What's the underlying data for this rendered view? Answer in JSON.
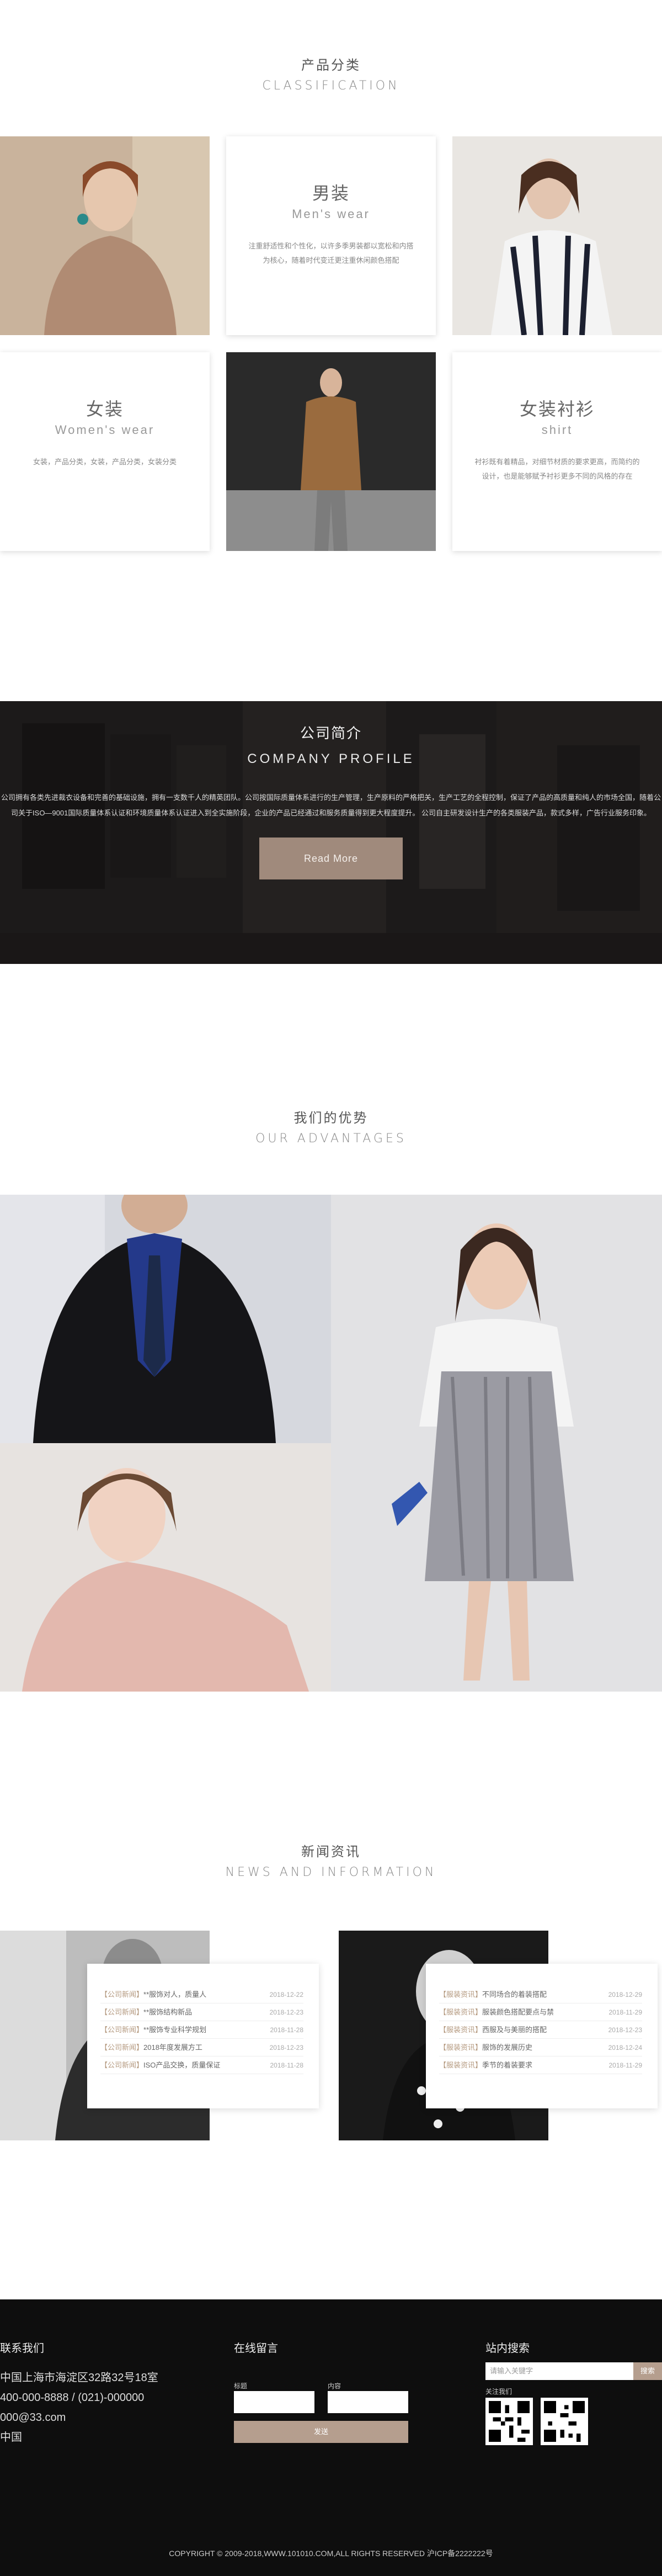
{
  "classification": {
    "title_cn": "产品分类",
    "title_en": "CLASSIFICATION",
    "cards": [
      {
        "cn": "男装",
        "en": "Men's wear",
        "desc": "注重舒适性和个性化，以许多季男装都以宽松和内搭为核心，随着时代变迁更注重休闲颜色搭配"
      },
      {
        "cn": "女装",
        "en": "Women's wear",
        "desc": "女装，产品分类，女装，产品分类，女装分类"
      },
      {
        "cn": "女装衬衫",
        "en": "shirt",
        "desc": "衬衫既有着精品，对细节材质的要求更高，而简约的设计，也是能够赋予衬衫更多不同的风格的存在"
      }
    ]
  },
  "profile": {
    "title_cn": "公司简介",
    "title_en": "COMPANY PROFILE",
    "text": "公司拥有各类先进裁衣设备和完善的基础设施，拥有一支数千人的精英团队。公司按国际质量体系进行的生产管理，生产原料的严格把关，生产工艺的全程控制，保证了产品的高质量和纯人的市场全国，随着公司关于ISO—9001国际质量体系认证和环境质量体系认证进入到全实施阶段，企业的产品已经通过和服务质量得到更大程度提升。 公司自主研发设计生产的各类服装产品，款式多样，广告行业服务印象。",
    "button": "Read More"
  },
  "advantages": {
    "title_cn": "我们的优势",
    "title_en": "OUR ADVANTAGES"
  },
  "news": {
    "title_cn": "新闻资讯",
    "title_en": "NEWS AND INFORMATION",
    "left": [
      {
        "tag": "【公司新闻】",
        "title": "**服饰对人，质量人",
        "date": "2018-12-22"
      },
      {
        "tag": "【公司新闻】",
        "title": "**服饰结构新品",
        "date": "2018-12-23"
      },
      {
        "tag": "【公司新闻】",
        "title": "**服饰专业科学规划",
        "date": "2018-11-28"
      },
      {
        "tag": "【公司新闻】",
        "title": "2018年度发展方工",
        "date": "2018-12-23"
      },
      {
        "tag": "【公司新闻】",
        "title": "ISO产品交换，质量保证",
        "date": "2018-11-28"
      }
    ],
    "right": [
      {
        "tag": "【服装资讯】",
        "title": "不同场合的着装搭配",
        "date": "2018-12-29"
      },
      {
        "tag": "【服装资讯】",
        "title": "服装颜色搭配要点与禁",
        "date": "2018-11-29"
      },
      {
        "tag": "【服装资讯】",
        "title": "西服及与美丽的搭配",
        "date": "2018-12-23"
      },
      {
        "tag": "【服装资讯】",
        "title": "服饰的发展历史",
        "date": "2018-12-24"
      },
      {
        "tag": "【服装资讯】",
        "title": "季节的着装要求",
        "date": "2018-11-29"
      }
    ]
  },
  "footer": {
    "contact_title": "联系我们",
    "address": "中国上海市海淀区32路32号18室",
    "phone": "400-000-8888  /  (021)-000000",
    "email": "000@33.com",
    "country": "中国",
    "message_title": "在线留言",
    "label_name": "标题",
    "label_content": "内容",
    "send": "发送",
    "search_title": "站内搜索",
    "search_placeholder": "请输入关键字",
    "search_button": "搜索",
    "follow": "关注我们",
    "copyright": "COPYRIGHT © 2009-2018,WWW.101010.COM,ALL RIGHTS RESERVED  沪ICP备2222222号"
  }
}
